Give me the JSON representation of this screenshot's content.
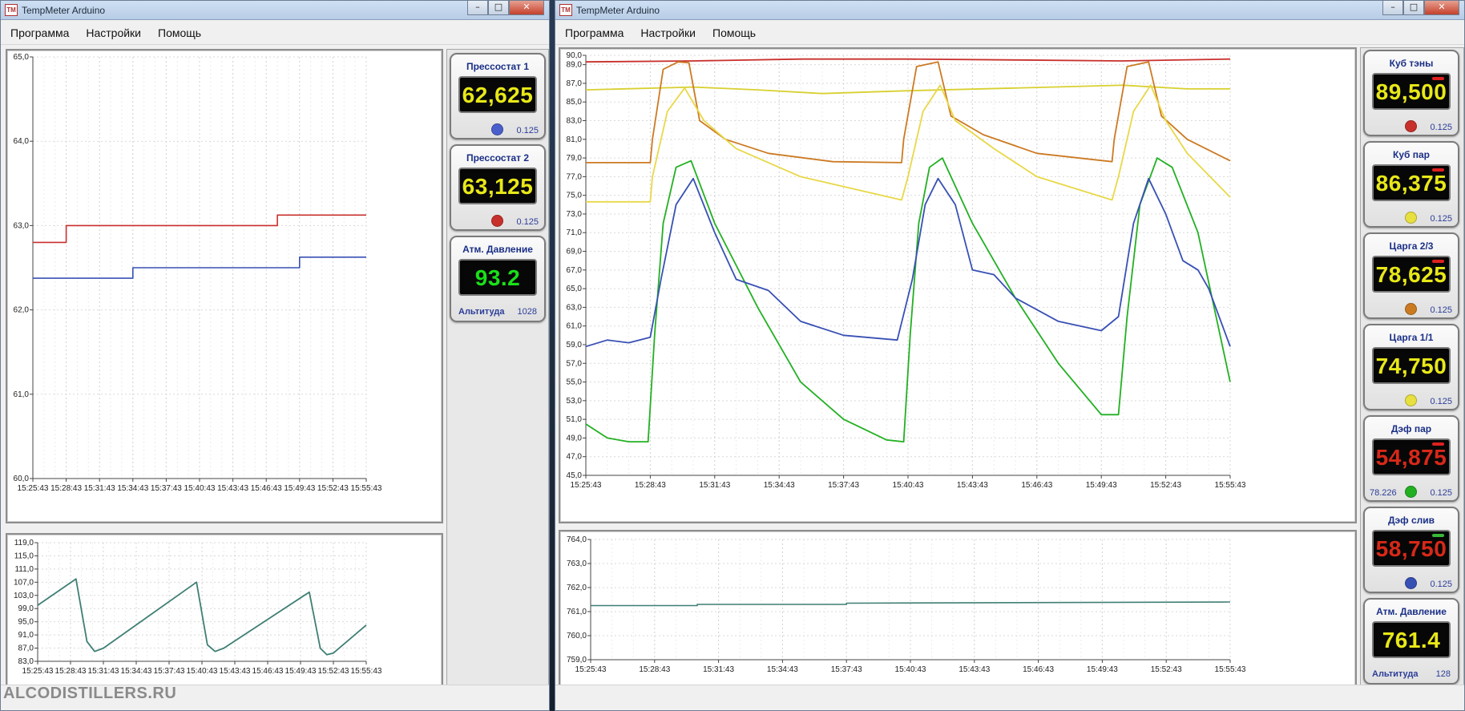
{
  "colors": {
    "red": "#c8302c",
    "blue": "#3850b4",
    "yellow": "#d8d030",
    "orange": "#cc7a22",
    "green": "#22b022",
    "teal": "#3f7f74",
    "lcd_yellow": "#e8e818",
    "lcd_green": "#19e019",
    "lcd_red": "#d82818"
  },
  "watermark": "ALCODISTILLERS.RU",
  "windows": [
    {
      "title": "TempMeter Arduino",
      "menu": [
        "Программа",
        "Настройки",
        "Помощь"
      ],
      "buttons": {
        "minimize": "–",
        "maximize": "□",
        "close": "✕"
      },
      "gauges": [
        {
          "title": "Прессостат 1",
          "value": "62,625",
          "value_color": "#e8e818",
          "dot_color": "#4a5fcc",
          "step": "0.125"
        },
        {
          "title": "Прессостат 2",
          "value": "63,125",
          "value_color": "#e8e818",
          "dot_color": "#c8302c",
          "step": "0.125"
        },
        {
          "title": "Атм. Давление",
          "value": "93.2",
          "value_color": "#19e019",
          "alt_label": "Альтитуда",
          "alt_value": "1028"
        }
      ]
    },
    {
      "title": "TempMeter Arduino",
      "menu": [
        "Программа",
        "Настройки",
        "Помощь"
      ],
      "buttons": {
        "minimize": "–",
        "maximize": "□",
        "close": "✕"
      },
      "gauges": [
        {
          "title": "Куб тэны",
          "value": "89,500",
          "value_color": "#e8e818",
          "dot_color": "#c8302c",
          "step": "0.125",
          "bar_color": "#e02020"
        },
        {
          "title": "Куб пар",
          "value": "86,375",
          "value_color": "#e8e818",
          "dot_color": "#e8e040",
          "step": "0.125",
          "bar_color": "#e02020"
        },
        {
          "title": "Царга 2/3",
          "value": "78,625",
          "value_color": "#e8e818",
          "dot_color": "#cc7a22",
          "step": "0.125",
          "bar_color": "#e02020"
        },
        {
          "title": "Царга 1/1",
          "value": "74,750",
          "value_color": "#e8e818",
          "dot_color": "#e8e040",
          "step": "0.125"
        },
        {
          "title": "Дэф пар",
          "value": "54,875",
          "value_color": "#d82818",
          "dot_color": "#22b022",
          "step": "0.125",
          "aux": "78.226",
          "bar_color": "#e02020"
        },
        {
          "title": "Дэф слив",
          "value": "58,750",
          "value_color": "#d82818",
          "dot_color": "#3850b4",
          "step": "0.125",
          "bar_color": "#38b838"
        },
        {
          "title": "Атм. Давление",
          "value": "761.4",
          "value_color": "#e8e818",
          "alt_label": "Альтитуда",
          "alt_value": "128"
        }
      ]
    }
  ],
  "chart_data": [
    {
      "type": "line",
      "x_ticks": [
        "15:25:43",
        "15:28:43",
        "15:31:43",
        "15:34:43",
        "15:37:43",
        "15:40:43",
        "15:43:43",
        "15:46:43",
        "15:49:43",
        "15:52:43",
        "15:55:43"
      ],
      "y_ticks": [
        "60,0",
        "61,0",
        "62,0",
        "63,0",
        "64,0",
        "65,0"
      ],
      "ylim": [
        60,
        65
      ],
      "xlim_minutes": [
        0,
        30
      ],
      "grid": true,
      "series": [
        {
          "color": "#c8302c",
          "style": "step",
          "points": [
            [
              0,
              62.8
            ],
            [
              3,
              62.8
            ],
            [
              3,
              63.0
            ],
            [
              22,
              63.0
            ],
            [
              22,
              63.125
            ],
            [
              30,
              63.125
            ]
          ]
        },
        {
          "color": "#3850b4",
          "style": "step",
          "points": [
            [
              0,
              62.375
            ],
            [
              9,
              62.375
            ],
            [
              9,
              62.5
            ],
            [
              24,
              62.5
            ],
            [
              24,
              62.625
            ],
            [
              30,
              62.625
            ]
          ]
        }
      ]
    },
    {
      "type": "line",
      "x_ticks": [
        "15:25:43",
        "15:28:43",
        "15:31:43",
        "15:34:43",
        "15:37:43",
        "15:40:43",
        "15:43:43",
        "15:46:43",
        "15:49:43",
        "15:52:43",
        "15:55:43"
      ],
      "y_ticks": [
        "83,0",
        "87,0",
        "91,0",
        "95,0",
        "99,0",
        "103,0",
        "107,0",
        "111,0",
        "115,0",
        "119,0"
      ],
      "ylim": [
        83,
        119
      ],
      "xlim_minutes": [
        0,
        30
      ],
      "grid": true,
      "series": [
        {
          "color": "#3f7f74",
          "style": "line",
          "points": [
            [
              0,
              100
            ],
            [
              3.5,
              108
            ],
            [
              4.5,
              89
            ],
            [
              5.2,
              86
            ],
            [
              6,
              87
            ],
            [
              14.5,
              107
            ],
            [
              15.5,
              88
            ],
            [
              16.2,
              86
            ],
            [
              17,
              87
            ],
            [
              24.8,
              104
            ],
            [
              25.8,
              87
            ],
            [
              26.4,
              85
            ],
            [
              27,
              85.5
            ],
            [
              30,
              94
            ]
          ]
        }
      ]
    },
    {
      "type": "line",
      "x_ticks": [
        "15:25:43",
        "15:28:43",
        "15:31:43",
        "15:34:43",
        "15:37:43",
        "15:40:43",
        "15:43:43",
        "15:46:43",
        "15:49:43",
        "15:52:43",
        "15:55:43"
      ],
      "y_ticks": [
        "45,0",
        "47,0",
        "49,0",
        "51,0",
        "53,0",
        "55,0",
        "57,0",
        "59,0",
        "61,0",
        "63,0",
        "65,0",
        "67,0",
        "69,0",
        "71,0",
        "73,0",
        "75,0",
        "77,0",
        "79,0",
        "81,0",
        "83,0",
        "85,0",
        "87,0",
        "89,0",
        "90,0"
      ],
      "ylim": [
        45,
        90
      ],
      "xlim_minutes": [
        0,
        30
      ],
      "grid": true,
      "series": [
        {
          "name": "Куб тэны",
          "color": "#c8302c",
          "points": [
            [
              0,
              89.3
            ],
            [
              5,
              89.4
            ],
            [
              10,
              89.6
            ],
            [
              15,
              89.6
            ],
            [
              20,
              89.5
            ],
            [
              25,
              89.4
            ],
            [
              30,
              89.6
            ]
          ]
        },
        {
          "name": "Куб пар",
          "color": "#d8d030",
          "points": [
            [
              0,
              86.3
            ],
            [
              5,
              86.6
            ],
            [
              8,
              86.3
            ],
            [
              11,
              85.9
            ],
            [
              15,
              86.2
            ],
            [
              20,
              86.5
            ],
            [
              25,
              86.8
            ],
            [
              28,
              86.4
            ],
            [
              30,
              86.4
            ]
          ]
        },
        {
          "name": "Царга 2/3",
          "color": "#cc7a22",
          "points": [
            [
              0,
              78.5
            ],
            [
              3,
              78.5
            ],
            [
              3.1,
              81
            ],
            [
              3.6,
              88.5
            ],
            [
              4.3,
              89.3
            ],
            [
              4.8,
              89.2
            ],
            [
              5.3,
              83
            ],
            [
              6.5,
              81
            ],
            [
              8.5,
              79.5
            ],
            [
              11.5,
              78.6
            ],
            [
              14.7,
              78.5
            ],
            [
              14.8,
              81
            ],
            [
              15.4,
              88.8
            ],
            [
              16.4,
              89.3
            ],
            [
              17,
              83.5
            ],
            [
              18.5,
              81.5
            ],
            [
              21,
              79.5
            ],
            [
              24.5,
              78.6
            ],
            [
              24.6,
              81
            ],
            [
              25.2,
              88.8
            ],
            [
              26.2,
              89.3
            ],
            [
              26.8,
              83.5
            ],
            [
              28,
              81
            ],
            [
              30,
              78.7
            ]
          ]
        },
        {
          "name": "Царга 1/1",
          "color": "#e8d848",
          "points": [
            [
              0,
              74.3
            ],
            [
              3,
              74.3
            ],
            [
              3.1,
              77
            ],
            [
              3.8,
              84
            ],
            [
              4.6,
              86.5
            ],
            [
              5.5,
              83
            ],
            [
              7,
              80
            ],
            [
              10,
              77
            ],
            [
              14.7,
              74.5
            ],
            [
              15,
              77
            ],
            [
              15.7,
              84
            ],
            [
              16.5,
              86.8
            ],
            [
              17.2,
              83
            ],
            [
              19,
              80
            ],
            [
              21,
              77
            ],
            [
              24.5,
              74.5
            ],
            [
              24.8,
              77
            ],
            [
              25.5,
              84
            ],
            [
              26.3,
              86.8
            ],
            [
              27,
              83
            ],
            [
              28,
              79.5
            ],
            [
              30,
              74.8
            ]
          ]
        },
        {
          "name": "Дэф пар",
          "color": "#22b022",
          "points": [
            [
              0,
              50.5
            ],
            [
              1,
              49
            ],
            [
              2,
              48.6
            ],
            [
              2.9,
              48.6
            ],
            [
              3.2,
              60
            ],
            [
              3.6,
              72
            ],
            [
              4.2,
              78
            ],
            [
              4.9,
              78.7
            ],
            [
              6,
              72
            ],
            [
              8,
              63
            ],
            [
              10,
              55
            ],
            [
              12,
              51
            ],
            [
              14,
              48.8
            ],
            [
              14.8,
              48.6
            ],
            [
              15.1,
              60
            ],
            [
              15.5,
              72
            ],
            [
              16,
              78
            ],
            [
              16.6,
              79
            ],
            [
              18,
              72
            ],
            [
              20,
              64
            ],
            [
              22,
              57
            ],
            [
              24,
              51.5
            ],
            [
              24.8,
              51.5
            ],
            [
              25.2,
              62
            ],
            [
              25.8,
              74
            ],
            [
              26.6,
              79
            ],
            [
              27.3,
              78
            ],
            [
              28.5,
              71
            ],
            [
              30,
              55
            ]
          ]
        },
        {
          "name": "Дэф слив",
          "color": "#3850b4",
          "points": [
            [
              0,
              58.8
            ],
            [
              1,
              59.5
            ],
            [
              2,
              59.2
            ],
            [
              3,
              59.8
            ],
            [
              3.5,
              66
            ],
            [
              4.2,
              74
            ],
            [
              5,
              76.8
            ],
            [
              6,
              71
            ],
            [
              7,
              66
            ],
            [
              8.5,
              64.8
            ],
            [
              10,
              61.5
            ],
            [
              12,
              60
            ],
            [
              14.5,
              59.5
            ],
            [
              15.2,
              66
            ],
            [
              15.8,
              74
            ],
            [
              16.4,
              76.8
            ],
            [
              17.2,
              74
            ],
            [
              18,
              67
            ],
            [
              19,
              66.5
            ],
            [
              20,
              64
            ],
            [
              22,
              61.5
            ],
            [
              24,
              60.5
            ],
            [
              24.8,
              62
            ],
            [
              25.5,
              72
            ],
            [
              26.2,
              76.8
            ],
            [
              27,
              73
            ],
            [
              27.8,
              68
            ],
            [
              28.5,
              67
            ],
            [
              29,
              65
            ],
            [
              30,
              58.8
            ]
          ]
        }
      ]
    },
    {
      "type": "line",
      "x_ticks": [
        "15:25:43",
        "15:28:43",
        "15:31:43",
        "15:34:43",
        "15:37:43",
        "15:40:43",
        "15:43:43",
        "15:46:43",
        "15:49:43",
        "15:52:43",
        "15:55:43"
      ],
      "y_ticks": [
        "759,0",
        "760,0",
        "761,0",
        "762,0",
        "763,0",
        "764,0"
      ],
      "ylim": [
        759,
        764
      ],
      "xlim_minutes": [
        0,
        30
      ],
      "grid": true,
      "series": [
        {
          "color": "#3f7f74",
          "style": "step",
          "points": [
            [
              0,
              761.25
            ],
            [
              5,
              761.25
            ],
            [
              5,
              761.3
            ],
            [
              12,
              761.3
            ],
            [
              12,
              761.35
            ],
            [
              30,
              761.4
            ]
          ]
        }
      ]
    }
  ]
}
